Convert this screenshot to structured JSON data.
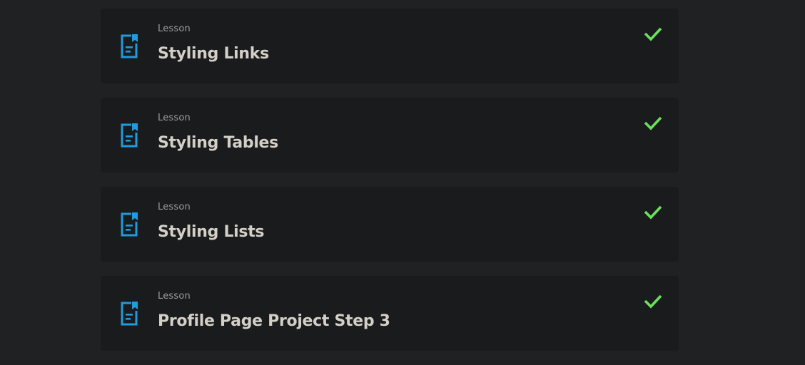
{
  "colors": {
    "icon_blue": "#1f9bde",
    "check_green": "#6be05a"
  },
  "lessons": [
    {
      "kind": "Lesson",
      "title": "Styling Links",
      "icon": "lesson-document-icon",
      "status_icon": "checkmark-icon"
    },
    {
      "kind": "Lesson",
      "title": "Styling Tables",
      "icon": "lesson-document-icon",
      "status_icon": "checkmark-icon"
    },
    {
      "kind": "Lesson",
      "title": "Styling Lists",
      "icon": "lesson-document-icon",
      "status_icon": "checkmark-icon"
    },
    {
      "kind": "Lesson",
      "title": "Profile Page Project Step 3",
      "icon": "lesson-document-icon",
      "status_icon": "checkmark-icon"
    }
  ]
}
